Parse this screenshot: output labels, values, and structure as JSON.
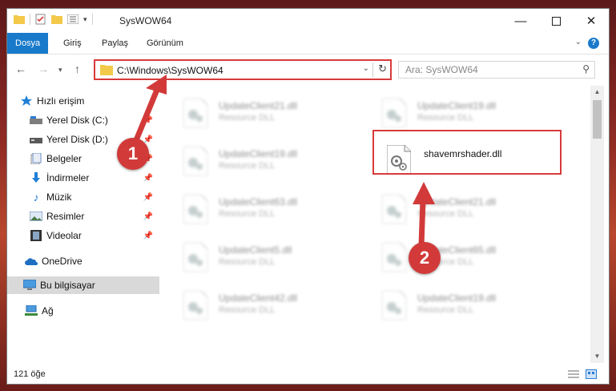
{
  "window": {
    "title": "SysWOW64"
  },
  "ribbon": {
    "tabs": [
      {
        "label": "Dosya",
        "active": true
      },
      {
        "label": "Giriş",
        "active": false
      },
      {
        "label": "Paylaş",
        "active": false
      },
      {
        "label": "Görünüm",
        "active": false
      }
    ]
  },
  "nav": {
    "address": "C:\\Windows\\SysWOW64",
    "search_placeholder": "Ara: SysWOW64"
  },
  "sidebar": {
    "items": [
      {
        "label": "Hızlı erişim",
        "icon": "star-icon"
      },
      {
        "label": "Yerel Disk (C:)",
        "icon": "drive-icon",
        "pinned": true
      },
      {
        "label": "Yerel Disk (D:)",
        "icon": "drive-icon",
        "pinned": true
      },
      {
        "label": "Belgeler",
        "icon": "documents-icon",
        "pinned": true
      },
      {
        "label": "İndirmeler",
        "icon": "download-icon",
        "pinned": true
      },
      {
        "label": "Müzik",
        "icon": "music-icon",
        "pinned": true
      },
      {
        "label": "Resimler",
        "icon": "pictures-icon",
        "pinned": true
      },
      {
        "label": "Videolar",
        "icon": "video-icon",
        "pinned": true
      },
      {
        "label": "OneDrive",
        "icon": "cloud-icon"
      },
      {
        "label": "Bu bilgisayar",
        "icon": "computer-icon",
        "selected": true
      },
      {
        "label": "Ağ",
        "icon": "network-icon"
      }
    ]
  },
  "files": {
    "left": [
      {
        "name": "UpdateClient21.dll",
        "desc": "Resource DLL"
      },
      {
        "name": "UpdateClient19.dll",
        "desc": "Resource DLL"
      },
      {
        "name": "UpdateClient63.dll",
        "desc": "Resource DLL"
      },
      {
        "name": "UpdateClient5.dll",
        "desc": "Resource DLL"
      },
      {
        "name": "UpdateClient42.dll",
        "desc": "Resource DLL"
      }
    ],
    "right": [
      {
        "name": "UpdateClient19.dll",
        "desc": "Resource DLL"
      },
      {
        "name": "shavemrshader.dll",
        "desc": "",
        "highlighted": true
      },
      {
        "name": "UpdateClient21.dll",
        "desc": "Resource DLL"
      },
      {
        "name": "UpdateClient65.dll",
        "desc": "Resource DLL"
      },
      {
        "name": "UpdateClient19.dll",
        "desc": "Resource DLL"
      }
    ]
  },
  "status": {
    "item_count": "121 öğe"
  },
  "markers": {
    "step1": "1",
    "step2": "2"
  },
  "colors": {
    "accent": "#1979ca",
    "highlight": "#d83a3a"
  }
}
